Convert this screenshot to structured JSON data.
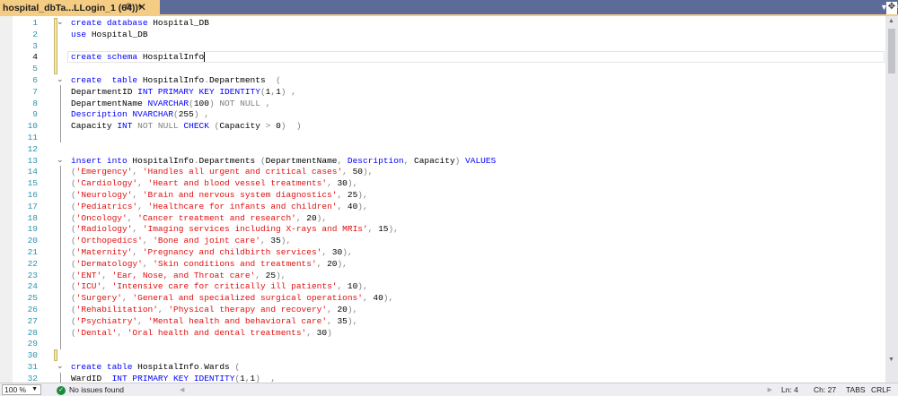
{
  "tab": {
    "title": "hospital_dbTa...LLogin_1 (64))*",
    "pin": "⊕",
    "close": "✕"
  },
  "status": {
    "zoom": "100 %",
    "issues": "No issues found",
    "ln": "Ln: 4",
    "ch": "Ch: 27",
    "tabs": "TABS",
    "eol": "CRLF"
  },
  "current_line": 4,
  "folds": [
    1,
    6,
    13,
    31
  ],
  "lines": [
    [
      [
        "k",
        "create database "
      ],
      [
        "t",
        "Hospital_DB"
      ]
    ],
    [
      [
        "k",
        "use "
      ],
      [
        "t",
        "Hospital_DB"
      ]
    ],
    [],
    [
      [
        "k",
        "create schema "
      ],
      [
        "t",
        "HospitalInfo"
      ]
    ],
    [],
    [
      [
        "k",
        "create  table "
      ],
      [
        "t",
        "HospitalInfo"
      ],
      [
        "g",
        "."
      ],
      [
        "t",
        "Departments  "
      ],
      [
        "g",
        "("
      ]
    ],
    [
      [
        "t",
        "DepartmentID "
      ],
      [
        "k",
        "INT PRIMARY KEY IDENTITY"
      ],
      [
        "g",
        "("
      ],
      [
        "t",
        "1"
      ],
      [
        "g",
        ","
      ],
      [
        "t",
        "1"
      ],
      [
        "g",
        ") ,"
      ]
    ],
    [
      [
        "t",
        "DepartmentName "
      ],
      [
        "k",
        "NVARCHAR"
      ],
      [
        "g",
        "("
      ],
      [
        "t",
        "100"
      ],
      [
        "g",
        ") NOT NULL ,"
      ]
    ],
    [
      [
        "k",
        "Description NVARCHAR"
      ],
      [
        "g",
        "("
      ],
      [
        "t",
        "255"
      ],
      [
        "g",
        ") ,"
      ]
    ],
    [
      [
        "t",
        "Capacity "
      ],
      [
        "k",
        "INT "
      ],
      [
        "g",
        "NOT NULL "
      ],
      [
        "k",
        "CHECK "
      ],
      [
        "g",
        "("
      ],
      [
        "t",
        "Capacity "
      ],
      [
        "g",
        ">"
      ],
      [
        "t",
        " 0"
      ],
      [
        "g",
        ")  )"
      ]
    ],
    [],
    [],
    [
      [
        "k",
        "insert into "
      ],
      [
        "t",
        "HospitalInfo"
      ],
      [
        "g",
        "."
      ],
      [
        "t",
        "Departments "
      ],
      [
        "g",
        "("
      ],
      [
        "t",
        "DepartmentName"
      ],
      [
        "g",
        ", "
      ],
      [
        "k",
        "Description"
      ],
      [
        "g",
        ", "
      ],
      [
        "t",
        "Capacity"
      ],
      [
        "g",
        ") "
      ],
      [
        "k",
        "VALUES"
      ]
    ],
    [
      [
        "g",
        "("
      ],
      [
        "s",
        "'Emergency'"
      ],
      [
        "g",
        ", "
      ],
      [
        "s",
        "'Handles all urgent and critical cases'"
      ],
      [
        "g",
        ", "
      ],
      [
        "t",
        "50"
      ],
      [
        "g",
        "),"
      ]
    ],
    [
      [
        "g",
        "("
      ],
      [
        "s",
        "'Cardiology'"
      ],
      [
        "g",
        ", "
      ],
      [
        "s",
        "'Heart and blood vessel treatments'"
      ],
      [
        "g",
        ", "
      ],
      [
        "t",
        "30"
      ],
      [
        "g",
        "),"
      ]
    ],
    [
      [
        "g",
        "("
      ],
      [
        "s",
        "'Neurology'"
      ],
      [
        "g",
        ", "
      ],
      [
        "s",
        "'Brain and nervous system diagnostics'"
      ],
      [
        "g",
        ", "
      ],
      [
        "t",
        "25"
      ],
      [
        "g",
        "),"
      ]
    ],
    [
      [
        "g",
        "("
      ],
      [
        "s",
        "'Pediatrics'"
      ],
      [
        "g",
        ", "
      ],
      [
        "s",
        "'Healthcare for infants and children'"
      ],
      [
        "g",
        ", "
      ],
      [
        "t",
        "40"
      ],
      [
        "g",
        "),"
      ]
    ],
    [
      [
        "g",
        "("
      ],
      [
        "s",
        "'Oncology'"
      ],
      [
        "g",
        ", "
      ],
      [
        "s",
        "'Cancer treatment and research'"
      ],
      [
        "g",
        ", "
      ],
      [
        "t",
        "20"
      ],
      [
        "g",
        "),"
      ]
    ],
    [
      [
        "g",
        "("
      ],
      [
        "s",
        "'Radiology'"
      ],
      [
        "g",
        ", "
      ],
      [
        "s",
        "'Imaging services including X-rays and MRIs'"
      ],
      [
        "g",
        ", "
      ],
      [
        "t",
        "15"
      ],
      [
        "g",
        "),"
      ]
    ],
    [
      [
        "g",
        "("
      ],
      [
        "s",
        "'Orthopedics'"
      ],
      [
        "g",
        ", "
      ],
      [
        "s",
        "'Bone and joint care'"
      ],
      [
        "g",
        ", "
      ],
      [
        "t",
        "35"
      ],
      [
        "g",
        "),"
      ]
    ],
    [
      [
        "g",
        "("
      ],
      [
        "s",
        "'Maternity'"
      ],
      [
        "g",
        ", "
      ],
      [
        "s",
        "'Pregnancy and childbirth services'"
      ],
      [
        "g",
        ", "
      ],
      [
        "t",
        "30"
      ],
      [
        "g",
        "),"
      ]
    ],
    [
      [
        "g",
        "("
      ],
      [
        "s",
        "'Dermatology'"
      ],
      [
        "g",
        ", "
      ],
      [
        "s",
        "'Skin conditions and treatments'"
      ],
      [
        "g",
        ", "
      ],
      [
        "t",
        "20"
      ],
      [
        "g",
        "),"
      ]
    ],
    [
      [
        "g",
        "("
      ],
      [
        "s",
        "'ENT'"
      ],
      [
        "g",
        ", "
      ],
      [
        "s",
        "'Ear, Nose, and Throat care'"
      ],
      [
        "g",
        ", "
      ],
      [
        "t",
        "25"
      ],
      [
        "g",
        "),"
      ]
    ],
    [
      [
        "g",
        "("
      ],
      [
        "s",
        "'ICU'"
      ],
      [
        "g",
        ", "
      ],
      [
        "s",
        "'Intensive care for critically ill patients'"
      ],
      [
        "g",
        ", "
      ],
      [
        "t",
        "10"
      ],
      [
        "g",
        "),"
      ]
    ],
    [
      [
        "g",
        "("
      ],
      [
        "s",
        "'Surgery'"
      ],
      [
        "g",
        ", "
      ],
      [
        "s",
        "'General and specialized surgical operations'"
      ],
      [
        "g",
        ", "
      ],
      [
        "t",
        "40"
      ],
      [
        "g",
        "),"
      ]
    ],
    [
      [
        "g",
        "("
      ],
      [
        "s",
        "'Rehabilitation'"
      ],
      [
        "g",
        ", "
      ],
      [
        "s",
        "'Physical therapy and recovery'"
      ],
      [
        "g",
        ", "
      ],
      [
        "t",
        "20"
      ],
      [
        "g",
        "),"
      ]
    ],
    [
      [
        "g",
        "("
      ],
      [
        "s",
        "'Psychiatry'"
      ],
      [
        "g",
        ", "
      ],
      [
        "s",
        "'Mental health and behavioral care'"
      ],
      [
        "g",
        ", "
      ],
      [
        "t",
        "35"
      ],
      [
        "g",
        "),"
      ]
    ],
    [
      [
        "g",
        "("
      ],
      [
        "s",
        "'Dental'"
      ],
      [
        "g",
        ", "
      ],
      [
        "s",
        "'Oral health and dental treatments'"
      ],
      [
        "g",
        ", "
      ],
      [
        "t",
        "30"
      ],
      [
        "g",
        ")"
      ]
    ],
    [],
    [],
    [
      [
        "k",
        "create table "
      ],
      [
        "t",
        "HospitalInfo"
      ],
      [
        "g",
        "."
      ],
      [
        "t",
        "Wards "
      ],
      [
        "g",
        "("
      ]
    ],
    [
      [
        "t",
        "WardID  "
      ],
      [
        "k",
        "INT PRIMARY KEY IDENTITY"
      ],
      [
        "g",
        "("
      ],
      [
        "t",
        "1"
      ],
      [
        "g",
        ","
      ],
      [
        "t",
        "1"
      ],
      [
        "g",
        ")  ,"
      ]
    ]
  ]
}
